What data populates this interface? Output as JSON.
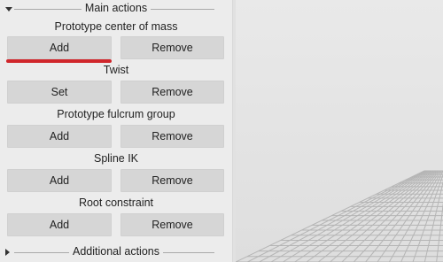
{
  "panel": {
    "main_section_title": "Main actions",
    "additional_section_title": "Additional actions",
    "groups": [
      {
        "label": "Prototype center of mass",
        "left_button": "Add",
        "right_button": "Remove"
      },
      {
        "label": "Twist",
        "left_button": "Set",
        "right_button": "Remove"
      },
      {
        "label": "Prototype fulcrum group",
        "left_button": "Add",
        "right_button": "Remove"
      },
      {
        "label": "Spline IK",
        "left_button": "Add",
        "right_button": "Remove"
      },
      {
        "label": "Root constraint",
        "left_button": "Add",
        "right_button": "Remove"
      }
    ]
  },
  "colors": {
    "highlight_underline": "#d0262b",
    "button_bg": "#d6d6d6",
    "panel_bg": "#ececec"
  },
  "icons": {
    "main_section": "triangle-down-icon",
    "additional_section": "triangle-right-icon"
  }
}
